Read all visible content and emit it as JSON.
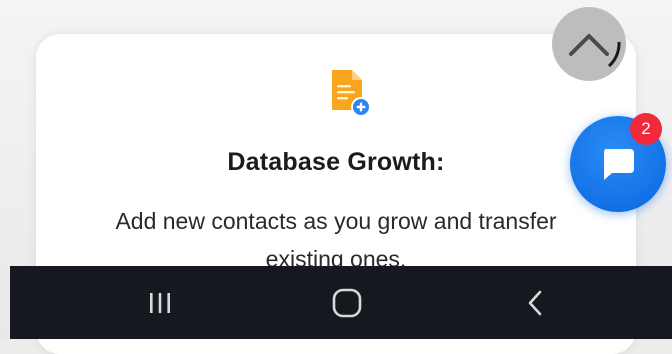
{
  "card": {
    "title": "Database Growth:",
    "description": "Add new contacts as you grow and transfer existing ones."
  },
  "chat": {
    "unread_count": "2"
  },
  "icons": {
    "feature": "document-add-icon",
    "scroll_top": "chevron-up-icon",
    "chat": "chat-bubble-icon",
    "nav_recent": "recent-apps-icon",
    "nav_home": "home-icon",
    "nav_back": "back-icon"
  },
  "colors": {
    "accent_orange": "#f9a51e",
    "accent_blue": "#1a80f0",
    "badge_red": "#f0293c",
    "nav_bg": "#15191f"
  }
}
